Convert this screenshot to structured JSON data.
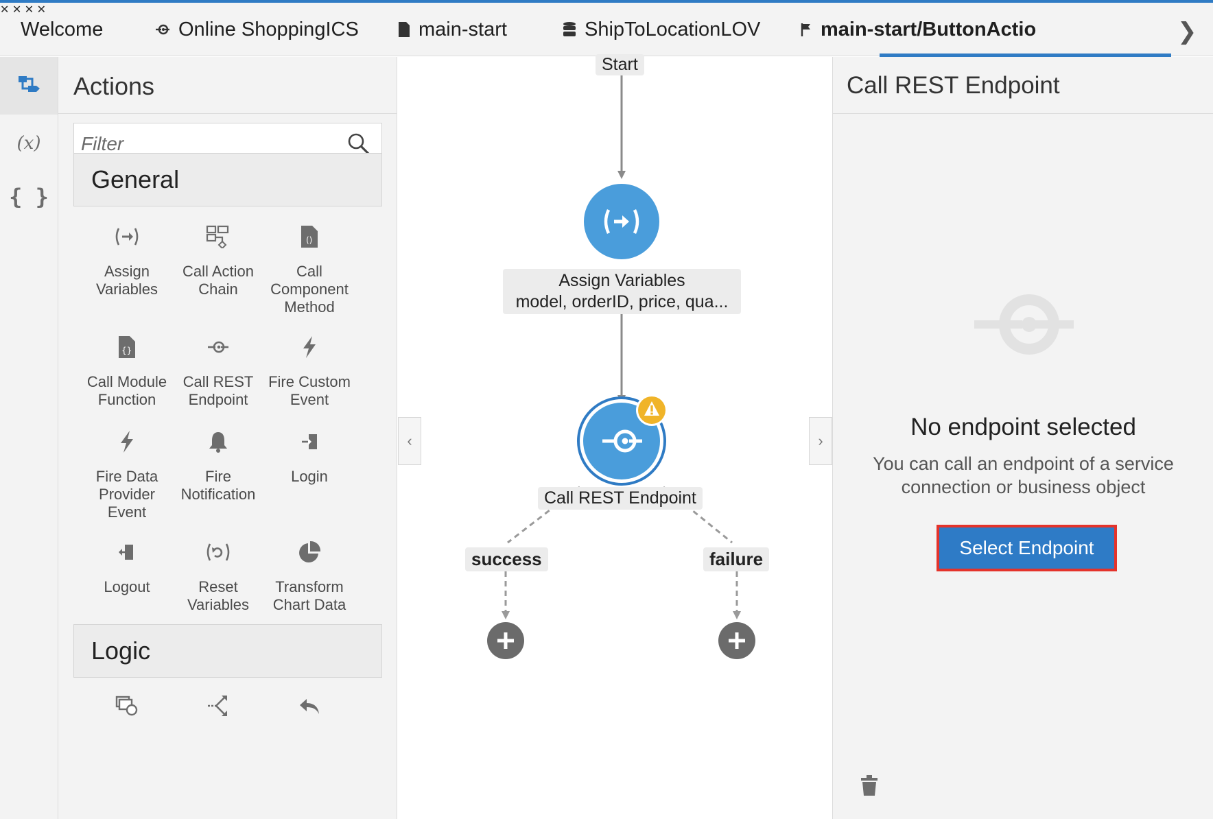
{
  "tabs": [
    {
      "label": "Welcome",
      "icon": "none",
      "closable": true
    },
    {
      "label": "Online ShoppingICS",
      "icon": "service-connection-icon",
      "closable": true
    },
    {
      "label": "main-start",
      "icon": "page-icon",
      "closable": true
    },
    {
      "label": "ShipToLocationLOV",
      "icon": "database-icon",
      "closable": true
    },
    {
      "label": "main-start/ButtonActionC",
      "icon": "flag-icon",
      "closable": false,
      "active": true
    }
  ],
  "strip": {
    "items": [
      "action-chain-icon",
      "variables-icon",
      "json-icon"
    ],
    "variables_text": "(x)",
    "json_text": "{ }"
  },
  "palette": {
    "title": "Actions",
    "filter_placeholder": "Filter",
    "categories": [
      {
        "name": "General",
        "items": [
          {
            "label": "Assign\nVariables",
            "icon": "assign-variables-icon"
          },
          {
            "label": "Call Action\nChain",
            "icon": "call-action-chain-icon"
          },
          {
            "label": "Call\nComponent\nMethod",
            "icon": "call-component-method-icon"
          },
          {
            "label": "Call Module\nFunction",
            "icon": "call-module-function-icon"
          },
          {
            "label": "Call REST\nEndpoint",
            "icon": "call-rest-endpoint-icon"
          },
          {
            "label": "Fire Custom\nEvent",
            "icon": "lightning-icon"
          },
          {
            "label": "Fire Data\nProvider\nEvent",
            "icon": "lightning-icon"
          },
          {
            "label": "Fire\nNotification",
            "icon": "bell-icon"
          },
          {
            "label": "Login",
            "icon": "login-icon"
          },
          {
            "label": "Logout",
            "icon": "logout-icon"
          },
          {
            "label": "Reset\nVariables",
            "icon": "reset-variables-icon"
          },
          {
            "label": "Transform\nChart Data",
            "icon": "pie-chart-icon"
          }
        ]
      },
      {
        "name": "Logic",
        "items": [
          {
            "label": "",
            "icon": "for-each-icon"
          },
          {
            "label": "",
            "icon": "if-icon"
          },
          {
            "label": "",
            "icon": "return-icon"
          }
        ]
      }
    ]
  },
  "canvas": {
    "start_label": "Start",
    "node1": {
      "title": "Assign Variables",
      "subtitle": "model, orderID, price, qua..."
    },
    "node2": {
      "title": "Call REST Endpoint",
      "warning": true
    },
    "branches": [
      "success",
      "failure"
    ],
    "collapse_left": "‹",
    "collapse_right": "›"
  },
  "properties": {
    "title": "Call REST Endpoint",
    "empty_title": "No endpoint selected",
    "empty_desc": "You can call an endpoint of a service connection or business object",
    "button_label": "Select Endpoint"
  },
  "colors": {
    "accent": "#2f7bc4",
    "node_blue": "#4a9ddb",
    "highlight_red": "#e4332b",
    "warning": "#f0b429"
  }
}
